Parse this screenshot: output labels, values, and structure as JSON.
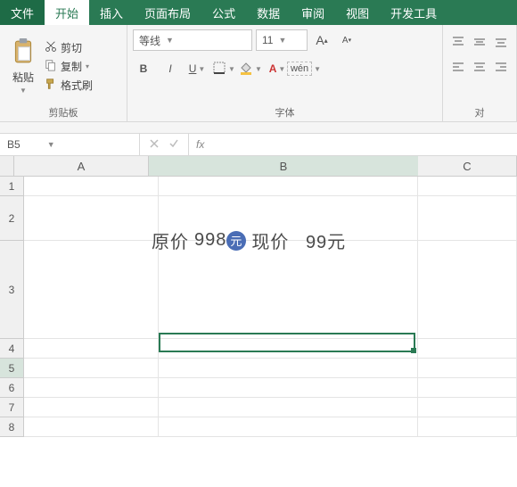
{
  "tabs": {
    "file": "文件",
    "home": "开始",
    "insert": "插入",
    "layout": "页面布局",
    "formula": "公式",
    "data": "数据",
    "review": "审阅",
    "view": "视图",
    "dev": "开发工具"
  },
  "clipboard": {
    "paste": "粘贴",
    "cut": "剪切",
    "copy": "复制",
    "format": "格式刷",
    "group": "剪贴板"
  },
  "font": {
    "name": "等线",
    "size": "11",
    "group": "字体",
    "wen": "wén"
  },
  "align": {
    "group": "对"
  },
  "namebox": {
    "ref": "B5",
    "fx": "fx"
  },
  "columns": {
    "A": "A",
    "B": "B",
    "C": "C"
  },
  "rownums": [
    "1",
    "2",
    "3",
    "4",
    "5",
    "6",
    "7",
    "8"
  ],
  "content": {
    "orig_label": "原价",
    "orig_val": "998",
    "badge": "元",
    "now_label": "现价",
    "now_val": "99元"
  }
}
